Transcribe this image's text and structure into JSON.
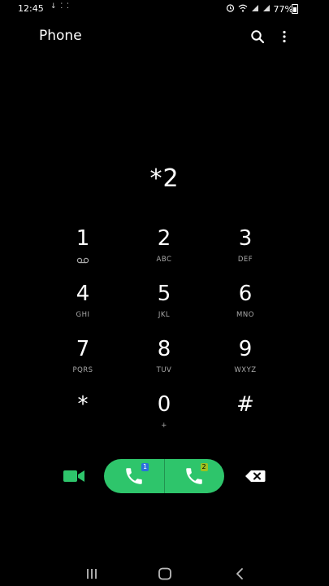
{
  "status": {
    "time": "12:45",
    "notifications": "↓ ⁚ ⁚",
    "battery": "77%"
  },
  "appbar": {
    "title": "Phone",
    "search_icon": "search-icon",
    "more_icon": "more-vertical-icon"
  },
  "dialer": {
    "number": "*2"
  },
  "keypad": {
    "keys": [
      {
        "digit": "1",
        "letters": ""
      },
      {
        "digit": "2",
        "letters": "ABC"
      },
      {
        "digit": "3",
        "letters": "DEF"
      },
      {
        "digit": "4",
        "letters": "GHI"
      },
      {
        "digit": "5",
        "letters": "JKL"
      },
      {
        "digit": "6",
        "letters": "MNO"
      },
      {
        "digit": "7",
        "letters": "PQRS"
      },
      {
        "digit": "8",
        "letters": "TUV"
      },
      {
        "digit": "9",
        "letters": "WXYZ"
      },
      {
        "digit": "*",
        "letters": ""
      },
      {
        "digit": "0",
        "letters": "+"
      },
      {
        "digit": "#",
        "letters": ""
      }
    ]
  },
  "actions": {
    "sim1_badge": "1",
    "sim2_badge": "2"
  },
  "colors": {
    "call_green": "#2ec56b",
    "video_green": "#2ec56b",
    "sim1_blue": "#2a6fdb",
    "sim2_lime": "#9ec21f"
  }
}
